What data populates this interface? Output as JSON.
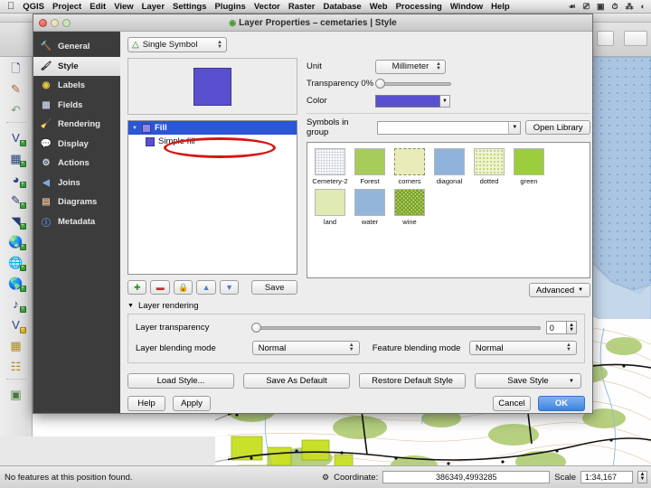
{
  "macmenu": {
    "apple": "apple-logo",
    "items": [
      "QGIS",
      "Project",
      "Edit",
      "View",
      "Layer",
      "Settings",
      "Plugins",
      "Vector",
      "Raster",
      "Database",
      "Web",
      "Processing",
      "Window",
      "Help"
    ],
    "status_icons": [
      "dropbox-icon",
      "screen-share-icon",
      "display-icon",
      "timemachine-icon",
      "bluetooth-icon",
      "wifi-icon"
    ]
  },
  "dialog": {
    "title": "Layer Properties – cemetaries | Style",
    "title_icon": "qgis-layer-icon",
    "traffic_lights": [
      "close",
      "minimize",
      "zoom"
    ],
    "sidebar": {
      "items": [
        {
          "label": "General",
          "icon": "tools-icon",
          "active": false
        },
        {
          "label": "Style",
          "icon": "brush-icon",
          "active": true
        },
        {
          "label": "Labels",
          "icon": "abc-icon",
          "active": false
        },
        {
          "label": "Fields",
          "icon": "table-icon",
          "active": false
        },
        {
          "label": "Rendering",
          "icon": "broom-icon",
          "active": false
        },
        {
          "label": "Display",
          "icon": "speech-icon",
          "active": false
        },
        {
          "label": "Actions",
          "icon": "gear-icon",
          "active": false
        },
        {
          "label": "Joins",
          "icon": "join-icon",
          "active": false
        },
        {
          "label": "Diagrams",
          "icon": "chart-icon",
          "active": false
        },
        {
          "label": "Metadata",
          "icon": "info-icon",
          "active": false
        }
      ]
    },
    "renderer": {
      "label": "Single Symbol",
      "icon": "single-symbol-icon"
    },
    "preview": {
      "color": "#5a4fcf"
    },
    "symbol_tree": {
      "rows": [
        {
          "label": "Fill",
          "color": "#8f88e0",
          "selected": true,
          "child": false
        },
        {
          "label": "Simple fill",
          "color": "#5a4fcf",
          "selected": false,
          "child": true
        }
      ]
    },
    "tree_buttons": [
      {
        "name": "add-symbol-layer-button",
        "glyph": "+"
      },
      {
        "name": "remove-symbol-layer-button",
        "glyph": "−"
      },
      {
        "name": "lock-symbol-layer-button",
        "glyph": "lock"
      },
      {
        "name": "move-up-button",
        "glyph": "up"
      },
      {
        "name": "move-down-button",
        "glyph": "down"
      }
    ],
    "save_symbol_label": "Save",
    "properties": {
      "unit_label": "Unit",
      "unit_value": "Millimeter",
      "transparency_label": "Transparency 0%",
      "transparency_value": 0,
      "color_label": "Color",
      "color_value": "#5a4fcf"
    },
    "symbols_group": {
      "label": "Symbols in group",
      "value": "",
      "open_library_label": "Open Library"
    },
    "symbol_library": [
      {
        "name": "Cemetery-2",
        "fill": "#ffffff",
        "pattern": "grid"
      },
      {
        "name": "Forest",
        "fill": "#a8cc5c",
        "pattern": "solid"
      },
      {
        "name": "corners",
        "fill": "#e8ecb8",
        "pattern": "corners"
      },
      {
        "name": "diagonal",
        "fill": "#90b3dc",
        "pattern": "solid"
      },
      {
        "name": "dotted",
        "fill": "#eef3cd",
        "pattern": "dots"
      },
      {
        "name": "green",
        "fill": "#9ccd3c",
        "pattern": "solid"
      },
      {
        "name": "land",
        "fill": "#dfeab4",
        "pattern": "solid"
      },
      {
        "name": "water",
        "fill": "#93b5da",
        "pattern": "solid"
      },
      {
        "name": "wine",
        "fill": "#b7d36a",
        "pattern": "zigzag"
      }
    ],
    "advanced_label": "Advanced",
    "layer_rendering": {
      "group_label": "Layer rendering",
      "transparency_label": "Layer transparency",
      "transparency_value": "0",
      "blending_label": "Layer blending mode",
      "blending_value": "Normal",
      "feature_blending_label": "Feature blending mode",
      "feature_blending_value": "Normal"
    },
    "style_buttons": [
      {
        "label": "Load Style...",
        "caret": false
      },
      {
        "label": "Save As Default",
        "caret": false
      },
      {
        "label": "Restore Default Style",
        "caret": false
      },
      {
        "label": "Save Style",
        "caret": true
      }
    ],
    "bottom_buttons": {
      "help": "Help",
      "apply": "Apply",
      "cancel": "Cancel",
      "ok": "OK"
    },
    "annotation": {
      "shape": "red-ellipse",
      "targets": "Simple fill"
    }
  },
  "statusbar": {
    "message": "No features at this position found.",
    "lock_icon": "render-lock-icon",
    "coordinate_label": "Coordinate:",
    "coordinate_value": "386349,4993285",
    "scale_label": "Scale",
    "scale_value": "1:34,167"
  },
  "left_toolbar": {
    "items": [
      {
        "name": "new-project-icon",
        "glyph": "❐"
      },
      {
        "name": "open-project-icon",
        "glyph": "✐"
      },
      {
        "name": "undo-icon",
        "glyph": "↶"
      },
      {
        "name": "add-vector-layer-icon",
        "glyph": "V"
      },
      {
        "name": "add-raster-layer-icon",
        "glyph": "▦"
      },
      {
        "name": "add-mesh-layer-icon",
        "glyph": "◔"
      },
      {
        "name": "add-delimited-text-layer-icon",
        "glyph": "✒"
      },
      {
        "name": "add-spatialite-layer-icon",
        "glyph": "◠"
      },
      {
        "name": "add-postgis-layer-icon",
        "glyph": "⊕"
      },
      {
        "name": "add-wms-layer-icon",
        "glyph": "☷"
      },
      {
        "name": "add-wfs-layer-icon",
        "glyph": "Ⓥ"
      },
      {
        "name": "new-shapefile-layer-icon",
        "glyph": "♪"
      },
      {
        "name": "new-spatialite-layer-icon",
        "glyph": "V"
      },
      {
        "name": "open-attribute-table-icon",
        "glyph": "⊞"
      },
      {
        "name": "open-field-calculator-icon",
        "glyph": "⌨"
      },
      {
        "name": "layer-properties-icon",
        "glyph": "◫"
      }
    ]
  },
  "colors": {
    "accent_purple": "#5a4fcf",
    "selection_blue": "#2b56d4",
    "sidebar_dark": "#3c3c3c",
    "annotation_red": "#d81414",
    "ok_button_blue": "#3c83e0"
  }
}
